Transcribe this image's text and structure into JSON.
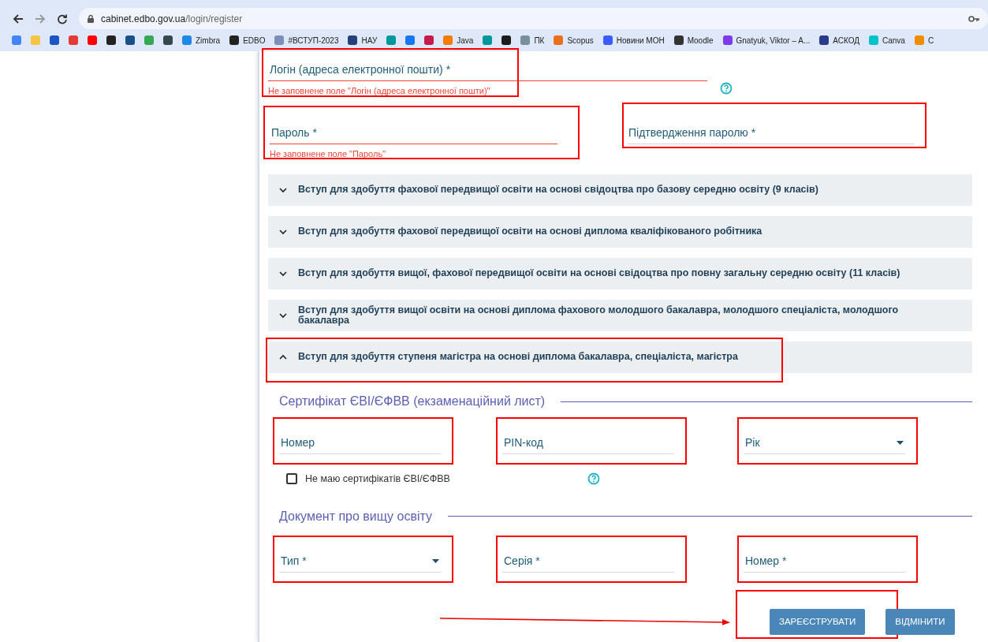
{
  "browser": {
    "url_host": "cabinet.edbo.gov.ua",
    "url_path": "/login/register",
    "bookmarks": [
      {
        "color": "#4285f4"
      },
      {
        "color": "#f6c343"
      },
      {
        "color": "#1a56c4"
      },
      {
        "color": "#e53935"
      },
      {
        "color": "#ff0000"
      },
      {
        "color": "#222222"
      },
      {
        "color": "#1b4f8a"
      },
      {
        "color": "#34a853"
      },
      {
        "color": "#37474f"
      },
      {
        "color": "#1e88e5",
        "label": "Zimbra"
      },
      {
        "color": "#222222",
        "label": "EDBO"
      },
      {
        "color": "#7b8fb8",
        "label": "#ВСТУП-2023"
      },
      {
        "color": "#24417a",
        "label": "НАУ"
      },
      {
        "color": "#00979d"
      },
      {
        "color": "#1877f2"
      },
      {
        "color": "#c51a4a"
      },
      {
        "color": "#f57c00",
        "label": "Java"
      },
      {
        "color": "#00979d"
      },
      {
        "color": "#1c1c1c"
      },
      {
        "color": "#78909c",
        "label": "ПК"
      },
      {
        "color": "#e9711c",
        "label": "Scopus"
      },
      {
        "color": "#3d5afe",
        "label": "Новини МОН"
      },
      {
        "color": "#333333",
        "label": "Moodle"
      },
      {
        "color": "#7c3aed",
        "label": "Gnatyuk, Viktor – A..."
      },
      {
        "color": "#2d3a8c",
        "label": "АСКОД"
      },
      {
        "color": "#00c4cc",
        "label": "Canva"
      },
      {
        "color": "#f08c00",
        "label": "C"
      }
    ]
  },
  "form": {
    "account_fields": [
      {
        "placeholder": "Логін (адреса електронної пошти) *",
        "error": "Не заповнене поле \"Логін (адреса електронної пошти)\"",
        "help": true,
        "highlighted": true
      },
      {
        "placeholder": "Пароль *",
        "error": "Не заповнене поле \"Пароль\"",
        "help": false,
        "highlighted": true
      },
      {
        "placeholder": "Підтвердження паролю *",
        "help": false,
        "highlighted": true
      }
    ],
    "accordions": [
      {
        "title": "Вступ для здобуття фахової передвищої освіти на основі свідоцтва про базову середню освіту (9 класів)",
        "expanded": false,
        "highlighted": false
      },
      {
        "title": "Вступ для здобуття фахової передвищої освіти на основі диплома кваліфікованого робітника",
        "expanded": false,
        "highlighted": false
      },
      {
        "title": "Вступ для здобуття вищої, фахової передвищої освіти на основі свідоцтва про повну загальну середню освіту (11 класів)",
        "expanded": false,
        "highlighted": false
      },
      {
        "title": "Вступ для здобуття вищої освіти на основі диплома фахового молодшого бакалавра, молодшого спеціаліста, молодшого бакалавра",
        "expanded": false,
        "highlighted": false
      },
      {
        "title": "Вступ для здобуття ступеня магістра на основі диплома бакалавра, спеціаліста, магістра",
        "expanded": true,
        "highlighted": true
      }
    ],
    "sections": [
      {
        "title": "Сертифікат ЄВІ/ЄФВВ (екзаменаційний лист)",
        "fields": [
          {
            "kind": "text",
            "placeholder": "Номер",
            "highlighted": true
          },
          {
            "kind": "text",
            "placeholder": "PIN-код",
            "highlighted": true
          },
          {
            "kind": "select",
            "placeholder": "Рік",
            "highlighted": true
          }
        ],
        "checkbox": {
          "label": "Не маю сертифікатів ЄВІ/ЄФВВ",
          "checked": false,
          "help": true
        }
      },
      {
        "title": "Документ про вищу освіту",
        "fields": [
          {
            "kind": "select",
            "placeholder": "Тип *",
            "highlighted": true
          },
          {
            "kind": "text",
            "placeholder": "Серія *",
            "highlighted": true
          },
          {
            "kind": "text",
            "placeholder": "Номер *",
            "highlighted": true
          }
        ]
      }
    ],
    "buttons": [
      {
        "label": "ЗАРЕЄСТРУВАТИ",
        "highlighted": true,
        "pointed": true
      },
      {
        "label": "ВІДМІНИТИ",
        "highlighted": false,
        "pointed": false
      }
    ]
  }
}
